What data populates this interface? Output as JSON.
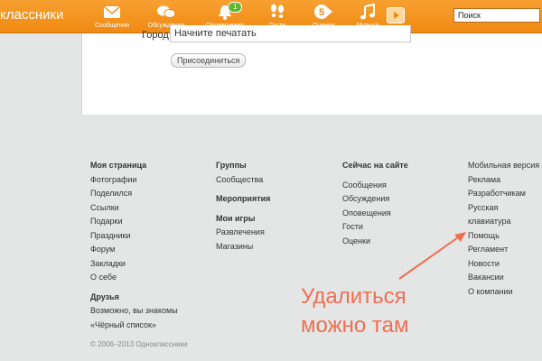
{
  "header": {
    "logo": "классники",
    "nav": [
      {
        "label": "Сообщения",
        "icon": "envelope-icon"
      },
      {
        "label": "Обсуждения",
        "icon": "chat-icon"
      },
      {
        "label": "Оповещения",
        "icon": "bell-icon",
        "badge": "1"
      },
      {
        "label": "Гости",
        "icon": "footprints-icon"
      },
      {
        "label": "Оценки",
        "icon": "rating-icon",
        "badge": "5"
      },
      {
        "label": "Музыка",
        "icon": "music-note-icon"
      }
    ],
    "search_value": "Поиск"
  },
  "form": {
    "city_label": "Город",
    "city_placeholder": "Начните печатать",
    "join_button": "Присоединиться"
  },
  "footer": {
    "col1": {
      "heading": "Моя страница",
      "links": [
        "Фотографии",
        "Поделился",
        "Ссылки",
        "Подарки",
        "Праздники",
        "Форум",
        "Закладки",
        "О себе"
      ],
      "heading2": "Друзья",
      "links2": [
        "Возможно, вы знакомы",
        "«Чёрный список»"
      ]
    },
    "col2": {
      "heading": "Группы",
      "links": [
        "Сообщества"
      ],
      "heading2": "Мероприятия",
      "heading3": "Мои игры",
      "links3": [
        "Развлечения",
        "Магазины"
      ]
    },
    "col3": {
      "heading": "Сейчас на сайте",
      "links": [
        "Сообщения",
        "Обсуждения",
        "Оповещения",
        "Гости",
        "Оценки"
      ]
    },
    "col4": {
      "links": [
        "Мобильная версия",
        "Реклама",
        "Разработчикам",
        "Русская клавиатура",
        "Помощь",
        "Регламент",
        "Новости",
        "Вакансии",
        "О компании"
      ]
    },
    "copyright": "© 2006–2013 Одноклассники"
  },
  "annotation": {
    "line1": "Удалиться",
    "line2": "можно там",
    "color": "#f06e50"
  },
  "colors": {
    "brand": "#f08a12",
    "footer_bg": "#e4e6e6"
  }
}
